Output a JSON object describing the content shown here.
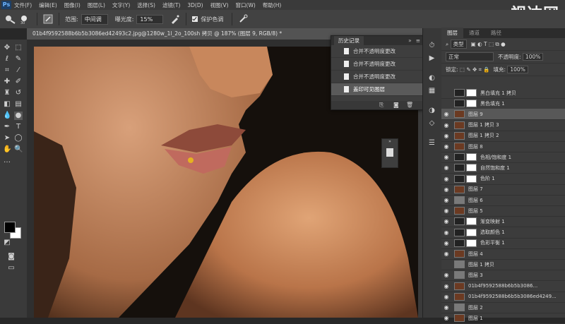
{
  "menubar": {
    "logo": "Ps",
    "items": [
      "文件(F)",
      "编辑(E)",
      "图像(I)",
      "图层(L)",
      "文字(Y)",
      "选择(S)",
      "滤镜(T)",
      "3D(D)",
      "视图(V)",
      "窗口(W)",
      "帮助(H)"
    ]
  },
  "options": {
    "range_label": "范围:",
    "range_value": "中间调",
    "exposure_label": "曝光度:",
    "exposure_value": "15%",
    "protect_label": "保护色调"
  },
  "watermark": "视达网",
  "document": {
    "tab_title": "01b4f9592588b6b5b3086ed42493c2.jpg@1280w_1l_2o_100sh 拷贝 @ 187% (图层 9, RGB/8) *"
  },
  "history": {
    "tab": "历史记录",
    "items": [
      {
        "label": "合并不透明度更改",
        "active": false
      },
      {
        "label": "合并不透明度更改",
        "active": false
      },
      {
        "label": "合并不透明度更改",
        "active": false
      },
      {
        "label": "盖印可见图层",
        "active": true
      }
    ]
  },
  "layers_panel": {
    "tabs": [
      "图层",
      "通道",
      "路径"
    ],
    "kind_filter": "类型",
    "blend_mode": "正常",
    "opacity_label": "不透明度:",
    "opacity_value": "100%",
    "lock_label": "锁定:",
    "fill_label": "填充:",
    "fill_value": "100%",
    "layers": [
      {
        "name": "黑白填充 1 拷贝",
        "type": "adjustment",
        "visible": false,
        "selected": false
      },
      {
        "name": "黑色填充 1",
        "type": "adjustment",
        "visible": false,
        "selected": false
      },
      {
        "name": "图层 9",
        "type": "photo",
        "visible": true,
        "selected": true
      },
      {
        "name": "图层 1 拷贝 3",
        "type": "photo",
        "visible": true,
        "selected": false
      },
      {
        "name": "图层 1 拷贝 2",
        "type": "photo",
        "visible": true,
        "selected": false
      },
      {
        "name": "图层 8",
        "type": "photo",
        "visible": true,
        "selected": false
      },
      {
        "name": "色相/饱和度 1",
        "type": "adjustment",
        "visible": true,
        "selected": false
      },
      {
        "name": "自然饱和度 1",
        "type": "adjustment",
        "visible": true,
        "selected": false
      },
      {
        "name": "色阶 1",
        "type": "adjustment",
        "visible": true,
        "selected": false
      },
      {
        "name": "图层 7",
        "type": "photo",
        "visible": true,
        "selected": false
      },
      {
        "name": "图层 6",
        "type": "gray",
        "visible": true,
        "selected": false
      },
      {
        "name": "图层 5",
        "type": "photo",
        "visible": true,
        "selected": false
      },
      {
        "name": "渐变映射 1",
        "type": "adjustment",
        "visible": true,
        "selected": false
      },
      {
        "name": "选取颜色 1",
        "type": "adjustment",
        "visible": true,
        "selected": false
      },
      {
        "name": "色彩平衡 1",
        "type": "adjustment",
        "visible": true,
        "selected": false
      },
      {
        "name": "图层 4",
        "type": "photo",
        "visible": true,
        "selected": false
      },
      {
        "name": "图层 1 拷贝",
        "type": "gray",
        "visible": false,
        "selected": false
      },
      {
        "name": "图层 3",
        "type": "gray",
        "visible": true,
        "selected": false
      },
      {
        "name": "01b4f9592588b6b5b3086...",
        "type": "photo",
        "visible": true,
        "selected": false
      },
      {
        "name": "01b4f9592588b6b5b3086ed4249...",
        "type": "photo",
        "visible": true,
        "selected": false
      },
      {
        "name": "图层 2",
        "type": "gray",
        "visible": true,
        "selected": false
      },
      {
        "name": "图层 1",
        "type": "photo",
        "visible": true,
        "selected": false
      }
    ]
  },
  "colors": {
    "skin_light": "#d99a6e",
    "skin_shadow": "#7a4a2e",
    "background_dark": "#15100c",
    "selected_layer": "#585858"
  }
}
